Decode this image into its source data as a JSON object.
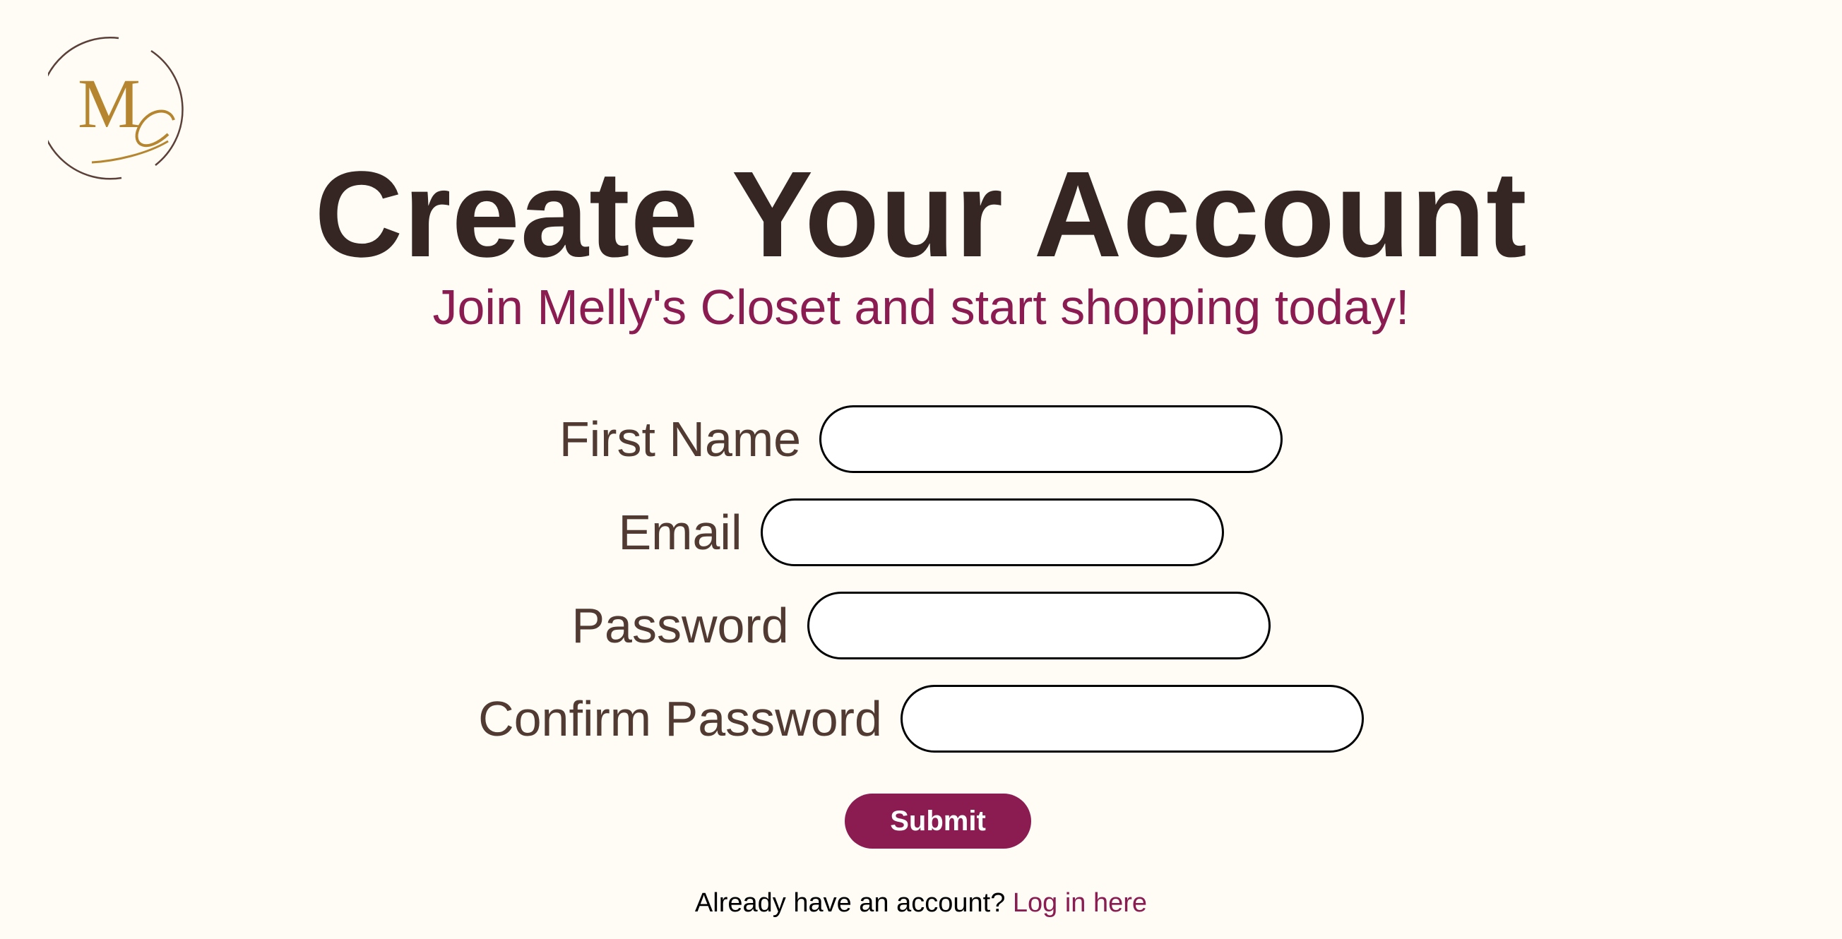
{
  "logo": {
    "monogram": "MC"
  },
  "header": {
    "title": "Create Your Account",
    "subtitle": "Join Melly's Closet and start shopping today!"
  },
  "form": {
    "fields": [
      {
        "label": "First Name",
        "value": ""
      },
      {
        "label": "Email",
        "value": ""
      },
      {
        "label": "Password",
        "value": ""
      },
      {
        "label": "Confirm Password",
        "value": ""
      }
    ],
    "submit_label": "Submit"
  },
  "footer": {
    "prompt": "Already have an account?",
    "link_label": "Log in here"
  },
  "colors": {
    "background": "#fffcf5",
    "title": "#352623",
    "accent": "#8a1c51",
    "label": "#503a31",
    "logo_gold": "#b5862f"
  }
}
